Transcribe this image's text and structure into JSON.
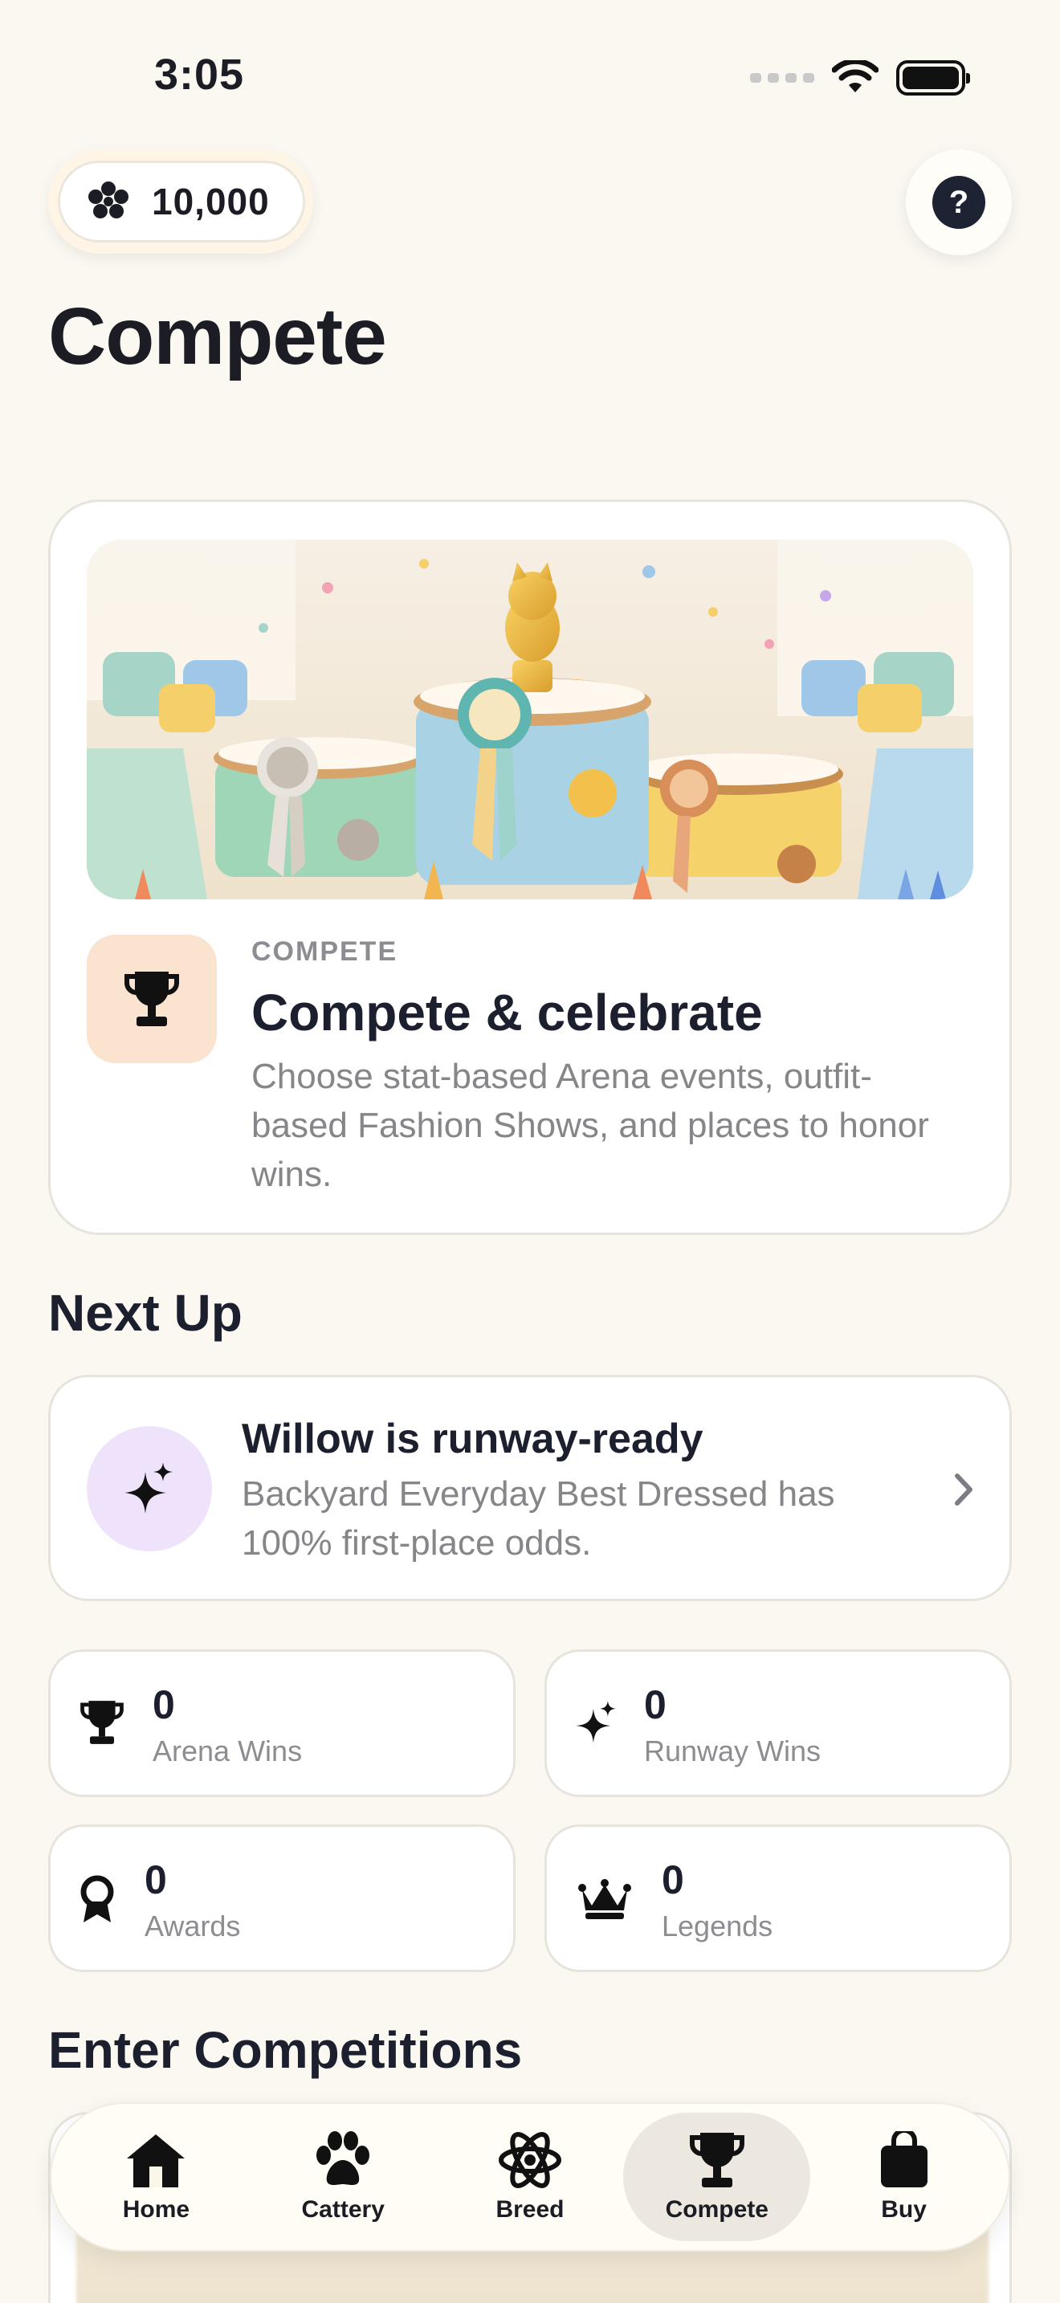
{
  "status_bar": {
    "time": "3:05"
  },
  "currency": {
    "amount": "10,000",
    "icon": "paw-cluster-icon"
  },
  "help": {
    "label": "?"
  },
  "page": {
    "title": "Compete"
  },
  "hero": {
    "eyebrow": "COMPETE",
    "title": "Compete & celebrate",
    "description": "Choose stat-based Arena events, outfit-based Fashion Shows, and places to honor wins.",
    "icon": "trophy-icon"
  },
  "next_up": {
    "heading": "Next Up",
    "title": "Willow is runway-ready",
    "description": "Backyard Everyday Best Dressed has 100% first-place odds.",
    "icon": "sparkles-icon"
  },
  "stats": [
    {
      "value": "0",
      "label": "Arena Wins",
      "icon": "trophy-icon"
    },
    {
      "value": "0",
      "label": "Runway Wins",
      "icon": "sparkles-icon"
    },
    {
      "value": "0",
      "label": "Awards",
      "icon": "award-ribbon-icon"
    },
    {
      "value": "0",
      "label": "Legends",
      "icon": "crown-icon"
    }
  ],
  "competitions": {
    "heading": "Enter Competitions"
  },
  "tabs": [
    {
      "label": "Home",
      "icon": "house-icon",
      "active": false
    },
    {
      "label": "Cattery",
      "icon": "paw-icon",
      "active": false
    },
    {
      "label": "Breed",
      "icon": "atom-icon",
      "active": false
    },
    {
      "label": "Compete",
      "icon": "trophy-icon",
      "active": true
    },
    {
      "label": "Buy",
      "icon": "shopping-bag-icon",
      "active": false
    }
  ],
  "colors": {
    "background": "#fbf8f1",
    "hero_icon_bg": "#fae3cf",
    "next_icon_bg": "#efe3fb",
    "help_button": "#1e2333"
  }
}
